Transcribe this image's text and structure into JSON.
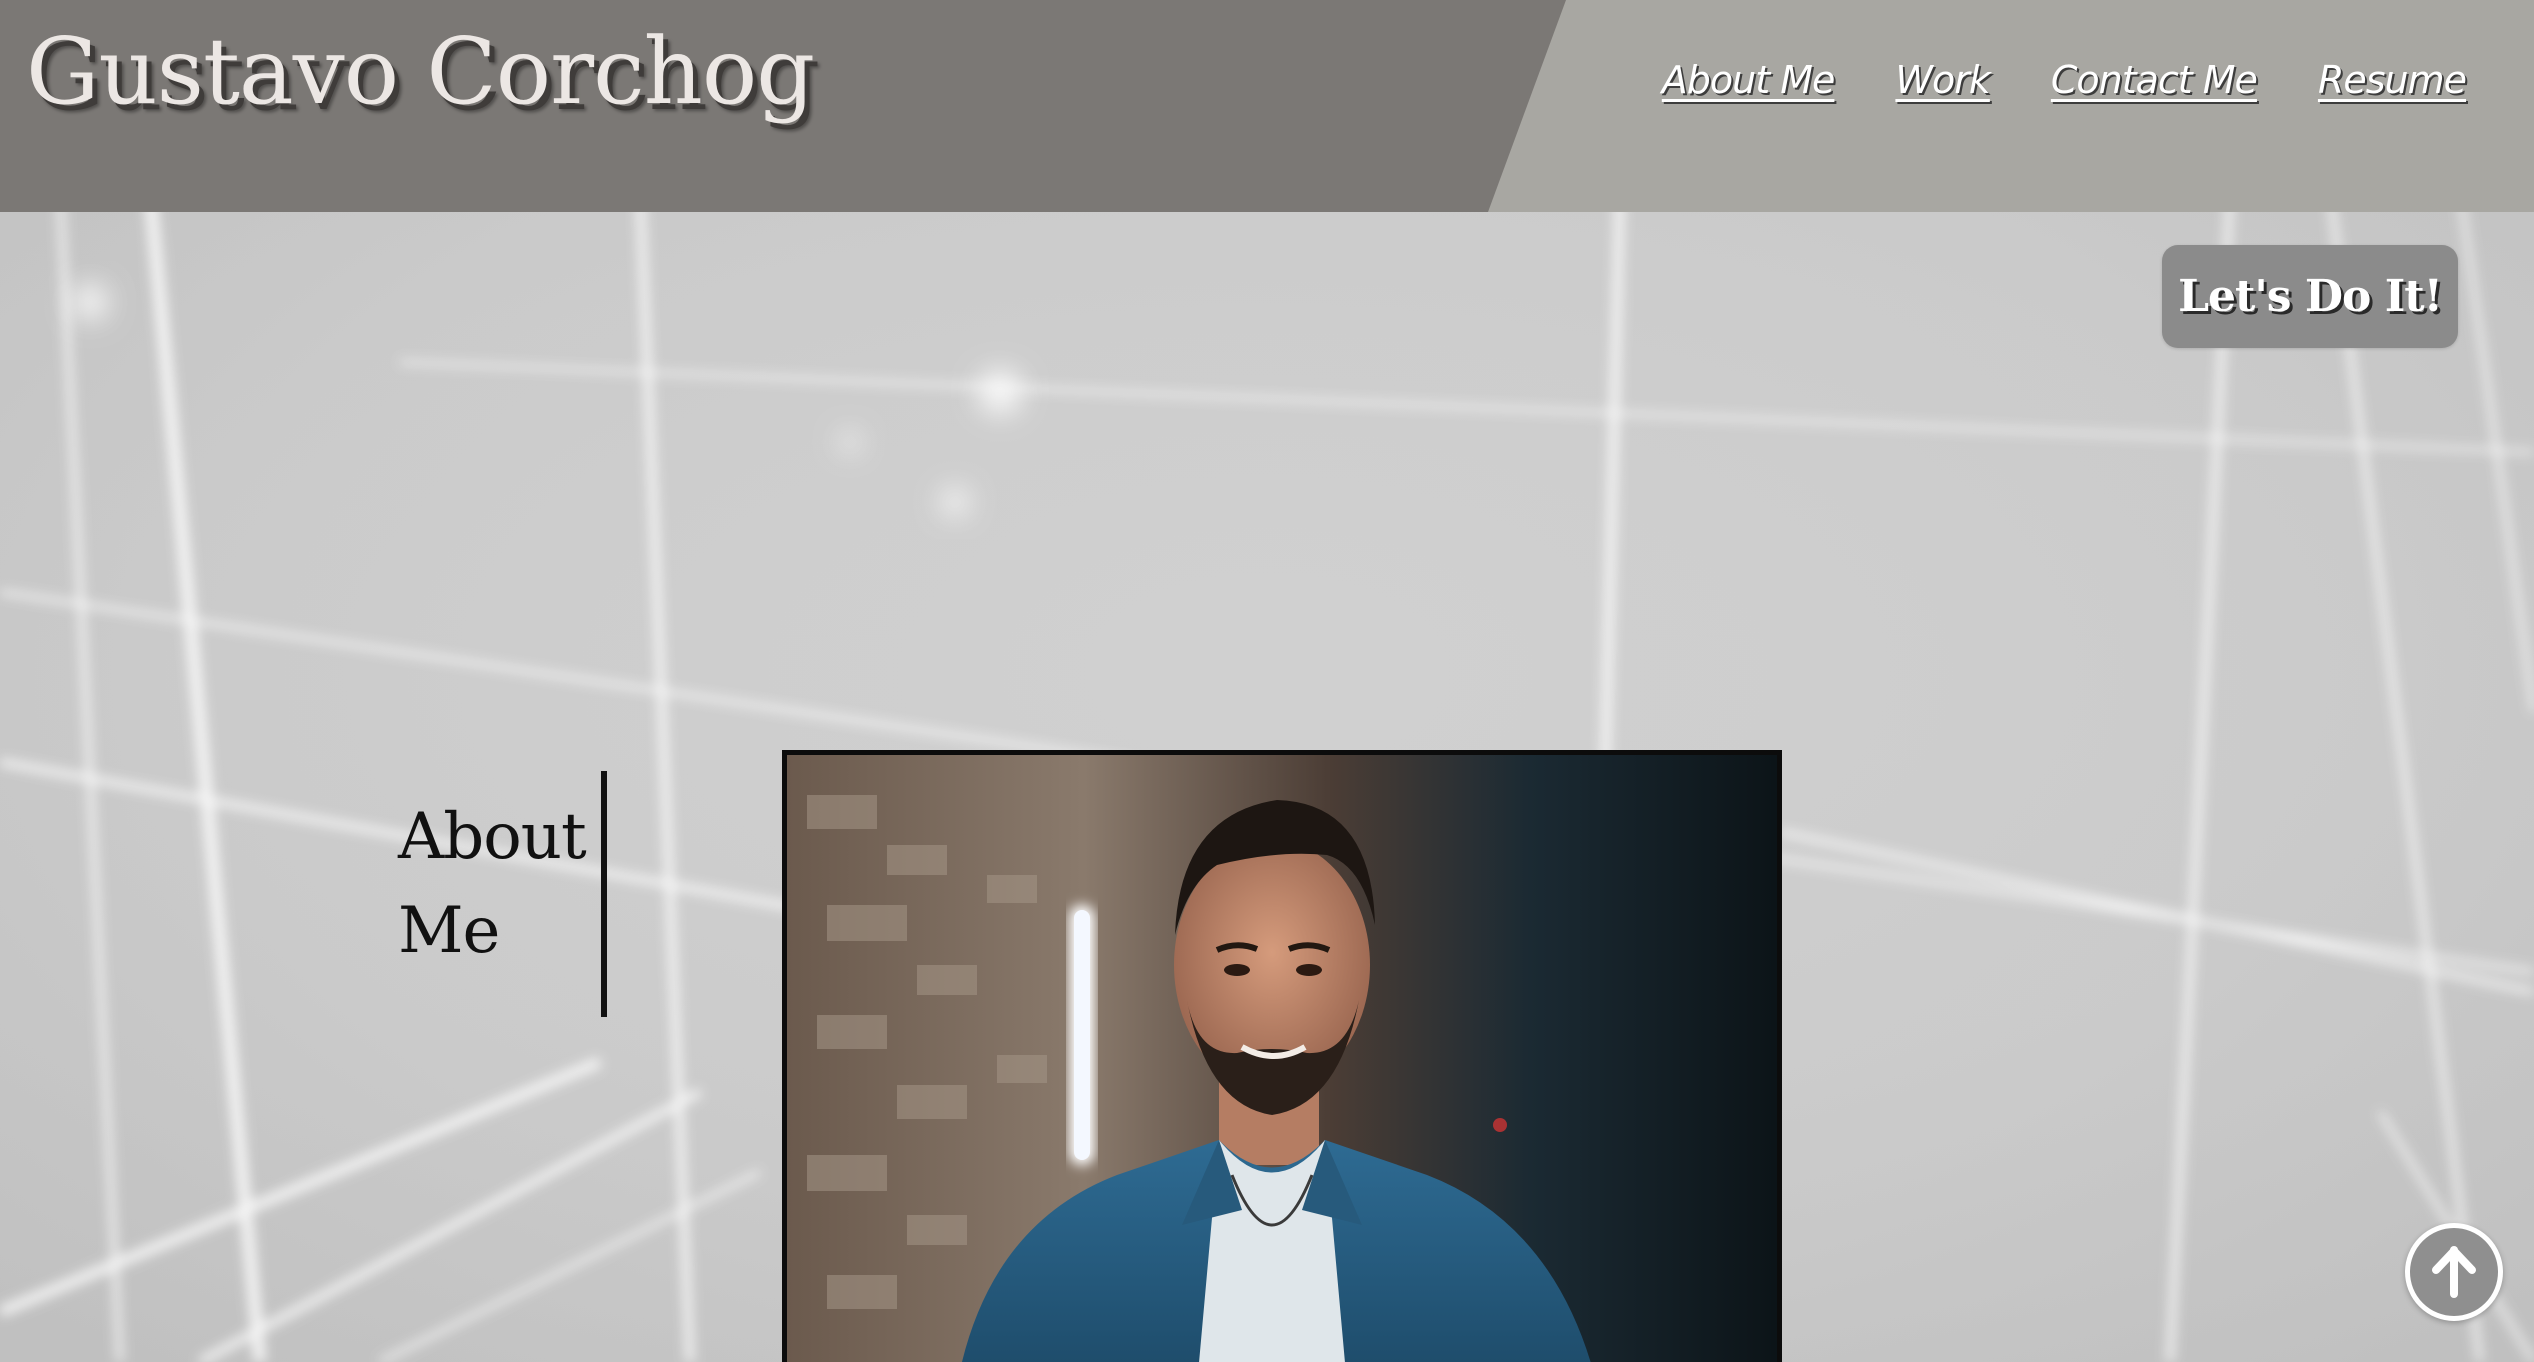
{
  "header": {
    "site_title": "Gustavo Corchog",
    "nav": [
      {
        "label": "About Me"
      },
      {
        "label": "Work"
      },
      {
        "label": "Contact Me"
      },
      {
        "label": "Resume"
      }
    ]
  },
  "cta": {
    "label": "Let's Do It!"
  },
  "about": {
    "heading_line1": "About",
    "heading_line2": "Me"
  },
  "photo": {
    "subject": "portrait of a smiling man in a blue denim shirt"
  },
  "back_to_top": {
    "icon": "arrow-up-circle-icon"
  },
  "colors": {
    "header_dark": "#7b7875",
    "header_light": "#a8a7a2",
    "page_background": "#d6d6d6",
    "cta_background": "#8b8b8b",
    "text_dark": "#111111"
  }
}
